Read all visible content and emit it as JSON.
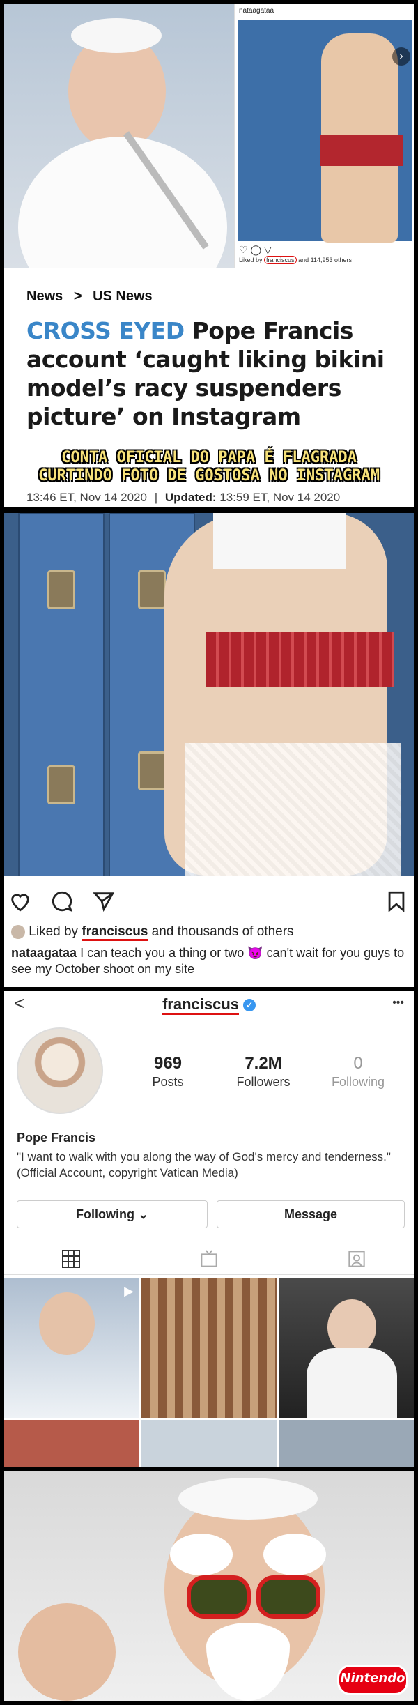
{
  "panel1": {
    "insta_post": {
      "username": "nataagataa",
      "liked_text_prefix": "Liked by",
      "liked_user": "franciscus",
      "liked_text_suffix": "and 114,953 others"
    },
    "breadcrumb": [
      "News",
      ">",
      "US News"
    ],
    "headline_kicker": "CROSS EYED",
    "headline_rest": "Pope Francis account ‘caught liking bikini model’s racy suspenders picture’ on Instagram",
    "meme_caption_line1": "CONTA OFICIAL DO PAPA É FLAGRADA",
    "meme_caption_line2": "CURTINDO FOTO DE GOSTOSA NO INSTAGRAM",
    "timestamp_published": "13:46 ET, Nov 14 2020",
    "timestamp_separator": "|",
    "timestamp_updated_label": "Updated:",
    "timestamp_updated": "13:59 ET, Nov 14 2020"
  },
  "panel2": {
    "liked_prefix": "Liked by",
    "liked_user": "franciscus",
    "liked_suffix": "and thousands of others",
    "caption_user": "nataagataa",
    "caption_text": "I can teach you a thing or two 😈 can't wait for you guys to see my October shoot on my site",
    "icons": [
      "heart-icon",
      "comment-icon",
      "share-icon",
      "bookmark-icon"
    ]
  },
  "panel3": {
    "back": "<",
    "username": "franciscus",
    "verified": "✓",
    "more": "•••",
    "stats": [
      {
        "num": "969",
        "label": "Posts"
      },
      {
        "num": "7.2M",
        "label": "Followers"
      },
      {
        "num": "0",
        "label": "Following"
      }
    ],
    "name": "Pope Francis",
    "bio": "\"I want to walk with you along the way of God's mercy and tenderness.\" (Official Account, copyright Vatican Media)",
    "following_btn": "Following ⌄",
    "message_btn": "Message"
  },
  "panel4": {
    "logo": "Nintendo"
  }
}
